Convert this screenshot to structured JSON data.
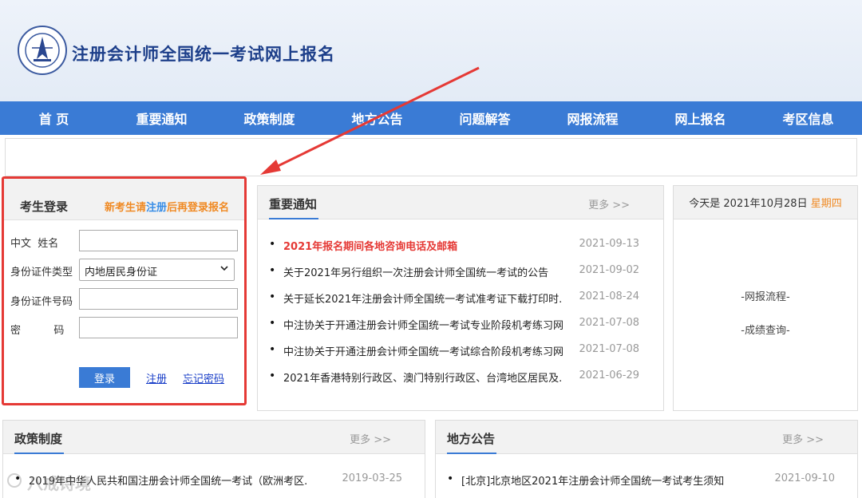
{
  "header": {
    "site_title": "注册会计师全国统一考试网上报名"
  },
  "nav": {
    "items": [
      "首 页",
      "重要通知",
      "政策制度",
      "地方公告",
      "问题解答",
      "网报流程",
      "网上报名",
      "考区信息"
    ]
  },
  "login": {
    "title": "考生登录",
    "tip_prefix": "新考生请",
    "tip_link": "注册",
    "tip_suffix": "后再登录报名",
    "name_label": "中文  姓名",
    "id_type_label": "身份证件类型",
    "id_type_value": "内地居民身份证",
    "id_number_label": "身份证件号码",
    "password_label": "密          码",
    "login_button": "登录",
    "register_link": "注册",
    "forgot_link": "忘记密码"
  },
  "notices": {
    "title": "重要通知",
    "more": "更多 >>",
    "items": [
      {
        "text": "2021年报名期间各地咨询电话及邮箱",
        "date": "2021-09-13"
      },
      {
        "text": "关于2021年另行组织一次注册会计师全国统一考试的公告",
        "date": "2021-09-02"
      },
      {
        "text": "关于延长2021年注册会计师全国统一考试准考证下载打印时...",
        "date": "2021-08-24"
      },
      {
        "text": "中注协关于开通注册会计师全国统一考试专业阶段机考练习网站...",
        "date": "2021-07-08"
      },
      {
        "text": "中注协关于开通注册会计师全国统一考试综合阶段机考练习网站...",
        "date": "2021-07-08"
      },
      {
        "text": "2021年香港特别行政区、澳门特别行政区、台湾地区居民及...",
        "date": "2021-06-29"
      }
    ]
  },
  "today": {
    "prefix": "今天是 2021年10月28日",
    "weekday": "星期四",
    "link1": "-网报流程-",
    "link2": "-成绩查询-"
  },
  "policy": {
    "title": "政策制度",
    "more": "更多 >>",
    "items": [
      {
        "text": "2019年中华人民共和国注册会计师全国统一考试（欧洲考区...",
        "date": "2019-03-25"
      }
    ]
  },
  "local": {
    "title": "地方公告",
    "more": "更多 >>",
    "items": [
      {
        "text": "[北京]北京地区2021年注册会计师全国统一考试考生须知",
        "date": "2021-09-10"
      }
    ]
  },
  "watermark": "八戒诗境"
}
